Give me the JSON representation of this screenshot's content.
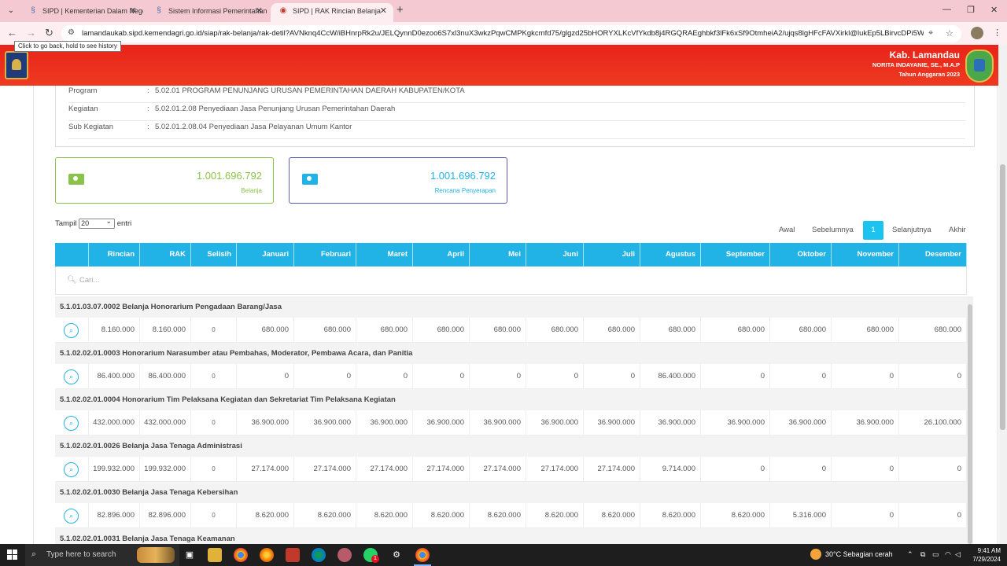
{
  "browser": {
    "tabs": [
      {
        "title": "SIPD | Kementerian Dalam Negeri"
      },
      {
        "title": "Sistem Informasi Pemerintahan Daerah"
      },
      {
        "title": "SIPD | RAK Rincian Belanja"
      }
    ],
    "url": "lamandaukab.sipd.kemendagri.go.id/siap/rak-belanja/rak-detil?AVNknq4CcW/iBHnrpRk2u/JELQynnD0ezoo6S7xl3nuX3wkzPqwCMPKgkcmfd75/glgzd25bHORYXLKcVfYkdb8j4RGQRAEghbkf3lFk6xSf9OtmheiA2/ujqs8lgHFcFAVXirkl@lukEp5LBirvcDPi5WbhrWXG...",
    "tooltip": "Click to go back, hold to see history"
  },
  "header": {
    "region": "Kab. Lamandau",
    "official": "NORITA INDAYANIE, SE., M.A.P",
    "fiscal_year": "Tahun Anggaran 2023"
  },
  "info": {
    "rows": [
      {
        "label": "Program",
        "value": "5.02.01 PROGRAM PENUNJANG URUSAN PEMERINTAHAN DAERAH KABUPATEN/KOTA"
      },
      {
        "label": "Kegiatan",
        "value": "5.02.01.2.08 Penyediaan Jasa Penunjang Urusan Pemerintahan Daerah"
      },
      {
        "label": "Sub Kegiatan",
        "value": "5.02.01.2.08.04 Penyediaan Jasa Pelayanan Umum Kantor"
      }
    ],
    "separator": ":"
  },
  "cards": [
    {
      "amount": "1.001.696.792",
      "label": "Belanja",
      "color": "#8bc34a"
    },
    {
      "amount": "1.001.696.792",
      "label": "Rencana Penyerapan",
      "color": "#22b3e6"
    }
  ],
  "table_controls": {
    "show_label": "Tampil",
    "page_size": "20",
    "entries_label": "entri",
    "pager": {
      "first": "Awal",
      "prev": "Sebelumnya",
      "current": "1",
      "next": "Selanjutnya",
      "last": "Akhir"
    },
    "search_placeholder": "Cari..."
  },
  "table": {
    "columns": [
      "",
      "Rincian",
      "RAK",
      "Selisih",
      "Januari",
      "Februari",
      "Maret",
      "April",
      "Mei",
      "Juni",
      "Juli",
      "Agustus",
      "September",
      "Oktober",
      "November",
      "Desember"
    ],
    "groups": [
      {
        "name": "5.1.01.03.07.0002 Belanja Honorarium Pengadaan Barang/Jasa",
        "values": [
          "8.160.000",
          "8.160.000",
          "0",
          "680.000",
          "680.000",
          "680.000",
          "680.000",
          "680.000",
          "680.000",
          "680.000",
          "680.000",
          "680.000",
          "680.000",
          "680.000",
          "680.000"
        ]
      },
      {
        "name": "5.1.02.02.01.0003 Honorarium Narasumber atau Pembahas, Moderator, Pembawa Acara, dan Panitia",
        "values": [
          "86.400.000",
          "86.400.000",
          "0",
          "0",
          "0",
          "0",
          "0",
          "0",
          "0",
          "0",
          "86.400.000",
          "0",
          "0",
          "0",
          "0"
        ]
      },
      {
        "name": "5.1.02.02.01.0004 Honorarium Tim Pelaksana Kegiatan dan Sekretariat Tim Pelaksana Kegiatan",
        "values": [
          "432.000.000",
          "432.000.000",
          "0",
          "36.900.000",
          "36.900.000",
          "36.900.000",
          "36.900.000",
          "36.900.000",
          "36.900.000",
          "36.900.000",
          "36.900.000",
          "36.900.000",
          "36.900.000",
          "36.900.000",
          "26.100.000"
        ]
      },
      {
        "name": "5.1.02.02.01.0026 Belanja Jasa Tenaga Administrasi",
        "values": [
          "199.932.000",
          "199.932.000",
          "0",
          "27.174.000",
          "27.174.000",
          "27.174.000",
          "27.174.000",
          "27.174.000",
          "27.174.000",
          "27.174.000",
          "9.714.000",
          "0",
          "0",
          "0",
          "0"
        ]
      },
      {
        "name": "5.1.02.02.01.0030 Belanja Jasa Tenaga Kebersihan",
        "values": [
          "82.896.000",
          "82.896.000",
          "0",
          "8.620.000",
          "8.620.000",
          "8.620.000",
          "8.620.000",
          "8.620.000",
          "8.620.000",
          "8.620.000",
          "8.620.000",
          "8.620.000",
          "5.316.000",
          "0",
          "0"
        ]
      },
      {
        "name": "5.1.02.02.01.0031 Belanja Jasa Tenaga Keamanan",
        "values": []
      }
    ]
  },
  "taskbar": {
    "search_placeholder": "Type here to search",
    "weather": "30°C  Sebagian cerah",
    "time": "9:41 AM",
    "date": "7/29/2024",
    "badge": "1"
  },
  "colors": {
    "accent": "#22b3e6",
    "header": "#e8241a",
    "active_page": "#1cc3ef",
    "belanja": "#8bc34a"
  }
}
